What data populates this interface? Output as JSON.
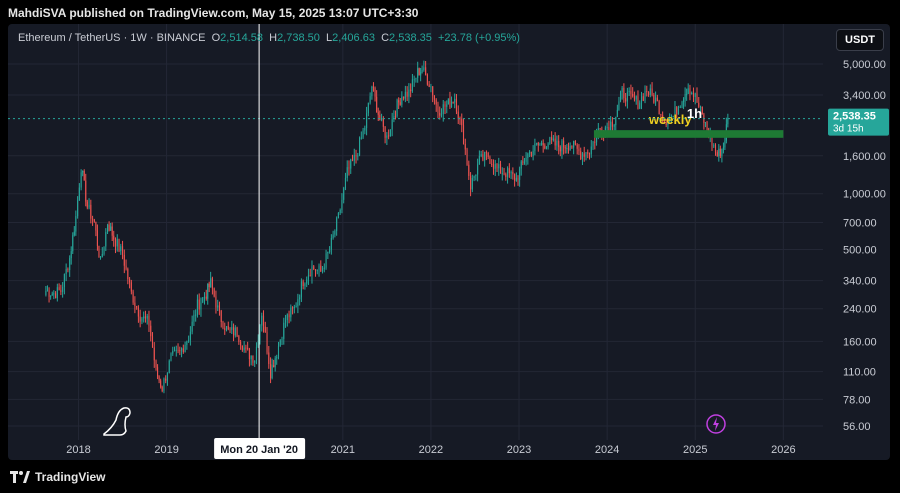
{
  "header": {
    "publish_text": "MahdiSVA published on TradingView.com, May 15, 2025 13:07 UTC+3:30"
  },
  "legend": {
    "symbol": "Ethereum / TetherUS · 1W · BINANCE",
    "o_label": "O",
    "o_value": "2,514.58",
    "h_label": "H",
    "h_value": "2,738.50",
    "l_label": "L",
    "l_value": "2,406.63",
    "c_label": "C",
    "c_value": "2,538.35",
    "change": "+23.78 (+0.95%)"
  },
  "toolbar": {
    "currency": "USDT"
  },
  "footer": {
    "brand": "TradingView"
  },
  "colors": {
    "up": "#26a69a",
    "down": "#ef5350",
    "zone": "#1e7a34",
    "bg": "#161a25",
    "label_yellow": "#f0d020"
  },
  "chart_data": {
    "type": "candlestick",
    "y_scale": "log",
    "ylim": [
      52,
      5800
    ],
    "xlim": [
      2017.2,
      2026.45
    ],
    "y_ticks": [
      {
        "value": 5000,
        "label": "5,000.00"
      },
      {
        "value": 3400,
        "label": "3,400.00"
      },
      {
        "value": 1600,
        "label": "1,600.00"
      },
      {
        "value": 1000,
        "label": "1,000.00"
      },
      {
        "value": 700,
        "label": "700.00"
      },
      {
        "value": 500,
        "label": "500.00"
      },
      {
        "value": 340,
        "label": "340.00"
      },
      {
        "value": 240,
        "label": "240.00"
      },
      {
        "value": 160,
        "label": "160.00"
      },
      {
        "value": 110,
        "label": "110.00"
      },
      {
        "value": 78,
        "label": "78.00"
      },
      {
        "value": 56,
        "label": "56.00"
      }
    ],
    "x_ticks": [
      {
        "value": 2018,
        "label": "2018"
      },
      {
        "value": 2019,
        "label": "2019"
      },
      {
        "value": 2021,
        "label": "2021"
      },
      {
        "value": 2022,
        "label": "2022"
      },
      {
        "value": 2023,
        "label": "2023"
      },
      {
        "value": 2024,
        "label": "2024"
      },
      {
        "value": 2025,
        "label": "2025"
      },
      {
        "value": 2026,
        "label": "2026"
      }
    ],
    "crosshair": {
      "x": 2020.05,
      "label": "Mon 20 Jan '20"
    },
    "last_price": {
      "value": 2538.35,
      "label": "2,538.35",
      "countdown": "3d 15h"
    },
    "zone": {
      "x_start": 2023.85,
      "x_end": 2026.0,
      "y_low": 2000,
      "y_high": 2200,
      "labels": [
        "weekly",
        "1h"
      ]
    },
    "series": [
      {
        "x": 2017.63,
        "y": 300
      },
      {
        "x": 2017.72,
        "y": 290
      },
      {
        "x": 2017.8,
        "y": 300
      },
      {
        "x": 2017.9,
        "y": 450
      },
      {
        "x": 2017.97,
        "y": 750
      },
      {
        "x": 2018.03,
        "y": 1400
      },
      {
        "x": 2018.1,
        "y": 850
      },
      {
        "x": 2018.18,
        "y": 700
      },
      {
        "x": 2018.25,
        "y": 420
      },
      {
        "x": 2018.33,
        "y": 700
      },
      {
        "x": 2018.4,
        "y": 580
      },
      {
        "x": 2018.5,
        "y": 470
      },
      {
        "x": 2018.6,
        "y": 290
      },
      {
        "x": 2018.7,
        "y": 220
      },
      {
        "x": 2018.8,
        "y": 200
      },
      {
        "x": 2018.88,
        "y": 110
      },
      {
        "x": 2018.95,
        "y": 90
      },
      {
        "x": 2019.05,
        "y": 130
      },
      {
        "x": 2019.15,
        "y": 140
      },
      {
        "x": 2019.25,
        "y": 170
      },
      {
        "x": 2019.35,
        "y": 250
      },
      {
        "x": 2019.45,
        "y": 290
      },
      {
        "x": 2019.5,
        "y": 330
      },
      {
        "x": 2019.6,
        "y": 220
      },
      {
        "x": 2019.7,
        "y": 180
      },
      {
        "x": 2019.8,
        "y": 180
      },
      {
        "x": 2019.9,
        "y": 140
      },
      {
        "x": 2020.0,
        "y": 130
      },
      {
        "x": 2020.08,
        "y": 230
      },
      {
        "x": 2020.18,
        "y": 110
      },
      {
        "x": 2020.25,
        "y": 140
      },
      {
        "x": 2020.35,
        "y": 210
      },
      {
        "x": 2020.45,
        "y": 240
      },
      {
        "x": 2020.55,
        "y": 340
      },
      {
        "x": 2020.65,
        "y": 400
      },
      {
        "x": 2020.75,
        "y": 380
      },
      {
        "x": 2020.85,
        "y": 500
      },
      {
        "x": 2020.95,
        "y": 740
      },
      {
        "x": 2021.05,
        "y": 1300
      },
      {
        "x": 2021.15,
        "y": 1600
      },
      {
        "x": 2021.25,
        "y": 2300
      },
      {
        "x": 2021.33,
        "y": 3800
      },
      {
        "x": 2021.42,
        "y": 2500
      },
      {
        "x": 2021.5,
        "y": 2000
      },
      {
        "x": 2021.58,
        "y": 2700
      },
      {
        "x": 2021.67,
        "y": 3400
      },
      {
        "x": 2021.75,
        "y": 3500
      },
      {
        "x": 2021.85,
        "y": 4500
      },
      {
        "x": 2021.9,
        "y": 4700
      },
      {
        "x": 2022.0,
        "y": 3800
      },
      {
        "x": 2022.08,
        "y": 2800
      },
      {
        "x": 2022.18,
        "y": 3000
      },
      {
        "x": 2022.27,
        "y": 3300
      },
      {
        "x": 2022.37,
        "y": 2000
      },
      {
        "x": 2022.45,
        "y": 1100
      },
      {
        "x": 2022.55,
        "y": 1500
      },
      {
        "x": 2022.65,
        "y": 1600
      },
      {
        "x": 2022.75,
        "y": 1350
      },
      {
        "x": 2022.85,
        "y": 1300
      },
      {
        "x": 2022.97,
        "y": 1200
      },
      {
        "x": 2023.08,
        "y": 1600
      },
      {
        "x": 2023.2,
        "y": 1800
      },
      {
        "x": 2023.33,
        "y": 1900
      },
      {
        "x": 2023.45,
        "y": 1800
      },
      {
        "x": 2023.58,
        "y": 1850
      },
      {
        "x": 2023.7,
        "y": 1650
      },
      {
        "x": 2023.8,
        "y": 1700
      },
      {
        "x": 2023.9,
        "y": 2200
      },
      {
        "x": 2024.0,
        "y": 2300
      },
      {
        "x": 2024.08,
        "y": 2500
      },
      {
        "x": 2024.17,
        "y": 3500
      },
      {
        "x": 2024.25,
        "y": 3300
      },
      {
        "x": 2024.35,
        "y": 3100
      },
      {
        "x": 2024.45,
        "y": 3600
      },
      {
        "x": 2024.55,
        "y": 3200
      },
      {
        "x": 2024.65,
        "y": 2500
      },
      {
        "x": 2024.75,
        "y": 2600
      },
      {
        "x": 2024.85,
        "y": 3300
      },
      {
        "x": 2024.92,
        "y": 3800
      },
      {
        "x": 2025.0,
        "y": 3300
      },
      {
        "x": 2025.08,
        "y": 2600
      },
      {
        "x": 2025.17,
        "y": 2000
      },
      {
        "x": 2025.25,
        "y": 1600
      },
      {
        "x": 2025.32,
        "y": 1800
      },
      {
        "x": 2025.37,
        "y": 2538
      }
    ]
  }
}
